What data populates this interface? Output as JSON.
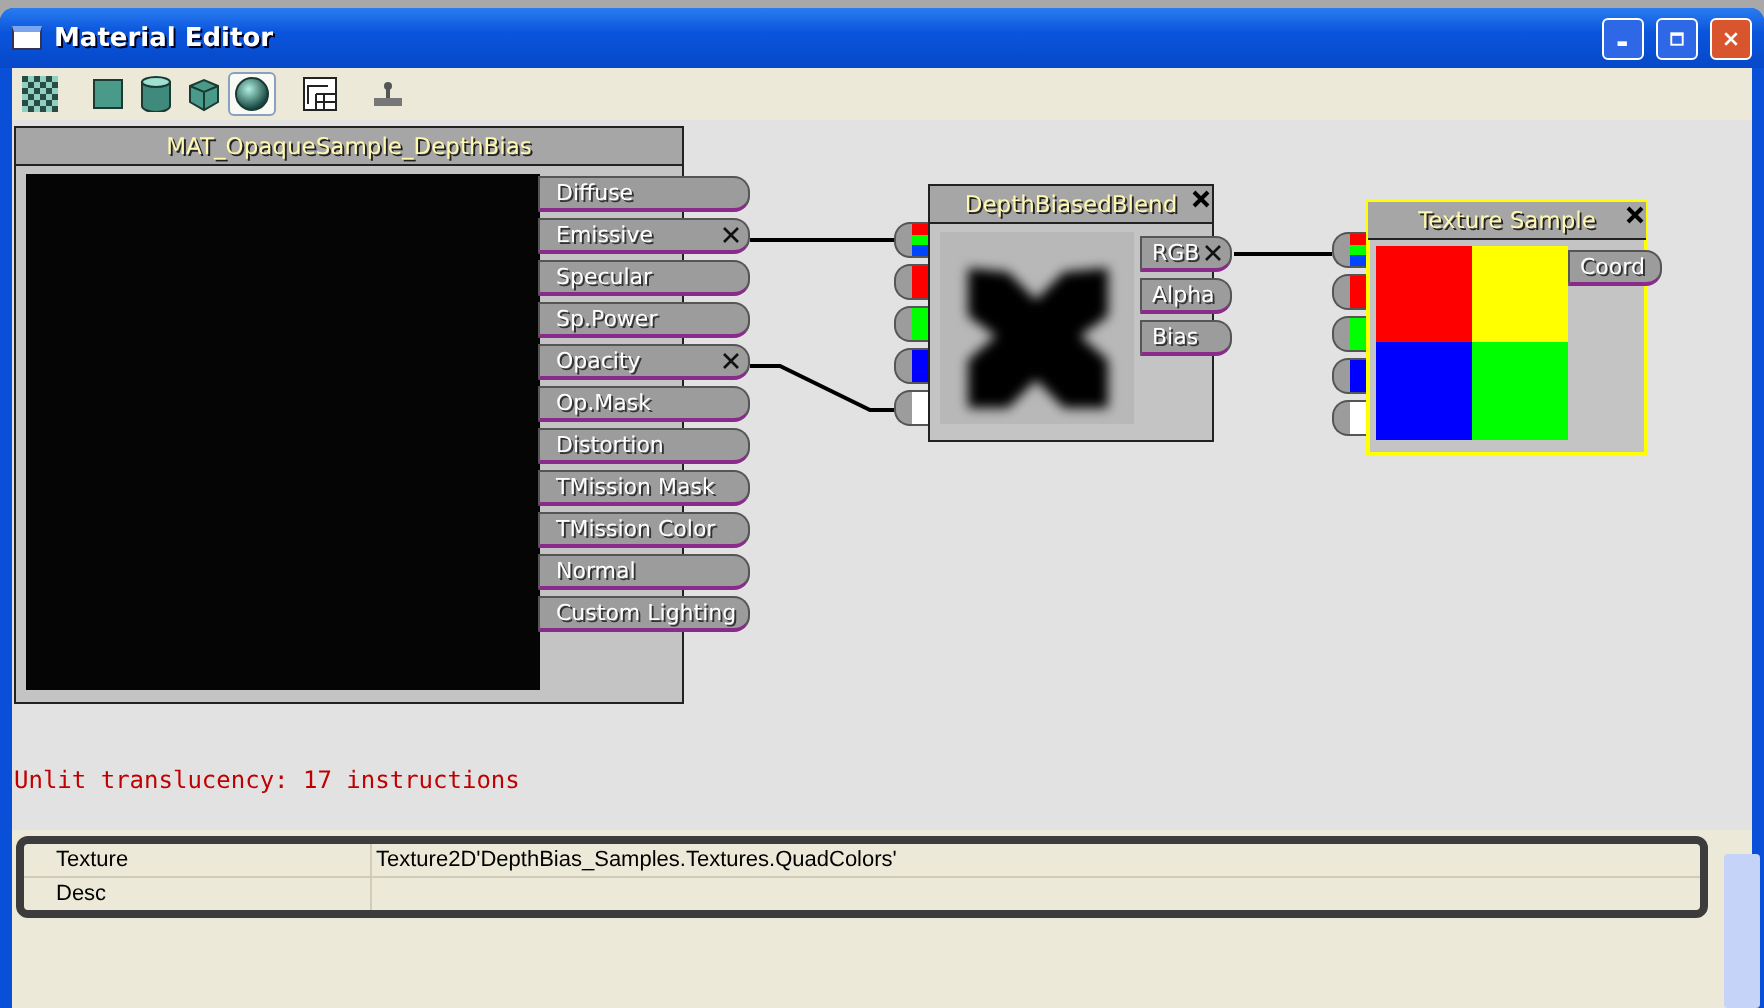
{
  "window": {
    "title": "Material Editor"
  },
  "toolbar": [
    {
      "kind": "checker",
      "selected": false
    },
    {
      "kind": "cube",
      "selected": false
    },
    {
      "kind": "cylinder",
      "selected": false
    },
    {
      "kind": "rounded-cube",
      "selected": false
    },
    {
      "kind": "sphere",
      "selected": true
    },
    {
      "kind": "grid",
      "selected": false
    },
    {
      "kind": "joystick",
      "selected": false
    }
  ],
  "nodes": [
    {
      "kind": "material",
      "title": "MAT_OpaqueSample_DepthBias",
      "selected": false,
      "inputs": [
        {
          "label": "Diffuse",
          "connected": false
        },
        {
          "label": "Emissive",
          "connected": true
        },
        {
          "label": "Specular",
          "connected": false
        },
        {
          "label": "Sp.Power",
          "connected": false
        },
        {
          "label": "Opacity",
          "connected": true
        },
        {
          "label": "Op.Mask",
          "connected": false
        },
        {
          "label": "Distortion",
          "connected": false
        },
        {
          "label": "TMission Mask",
          "connected": false
        },
        {
          "label": "TMission Color",
          "connected": false
        },
        {
          "label": "Normal",
          "connected": false
        },
        {
          "label": "Custom Lighting",
          "connected": false
        }
      ]
    },
    {
      "kind": "depth-blend",
      "title": "DepthBiasedBlend",
      "selected": false,
      "inputs": [
        {
          "kind": "rgb"
        },
        {
          "kind": "solid",
          "color": "#ff0000"
        },
        {
          "kind": "solid",
          "color": "#00ff00"
        },
        {
          "kind": "solid",
          "color": "#0000ff"
        },
        {
          "kind": "solid",
          "color": "#ffffff"
        }
      ],
      "outputs": [
        {
          "label": "RGB",
          "connected": true
        },
        {
          "label": "Alpha",
          "connected": false
        },
        {
          "label": "Bias",
          "connected": false
        }
      ]
    },
    {
      "kind": "texture",
      "title": "Texture Sample",
      "selected": true,
      "inputs": [
        {
          "kind": "rgb"
        },
        {
          "kind": "solid",
          "color": "#ff0000"
        },
        {
          "kind": "solid",
          "color": "#00ff00"
        },
        {
          "kind": "solid",
          "color": "#0000ff"
        },
        {
          "kind": "solid",
          "color": "#ffffff"
        }
      ],
      "outputs": [
        {
          "label": "Coord",
          "connected": false
        }
      ]
    }
  ],
  "status": "Unlit translucency: 17 instructions",
  "properties": [
    {
      "name": "Texture",
      "value": "Texture2D'DepthBias_Samples.Textures.QuadColors'"
    },
    {
      "name": "Desc"
    }
  ]
}
